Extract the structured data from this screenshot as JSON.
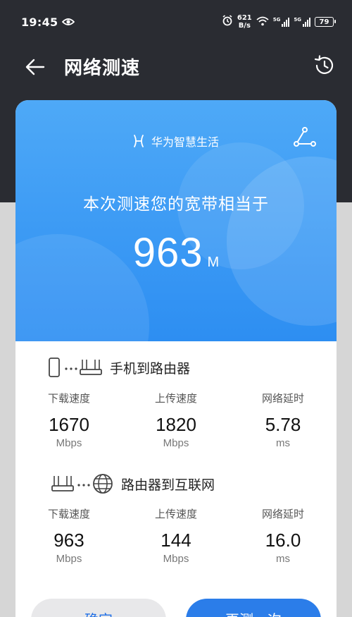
{
  "status_bar": {
    "time": "19:45",
    "net_speed_value": "621",
    "net_speed_unit": "B/s",
    "battery": "79",
    "sim1_label": "5G",
    "sim2_label": "5G"
  },
  "header": {
    "title": "网络测速"
  },
  "hero": {
    "brand": "华为智慧生活",
    "headline": "本次测速您的宽带相当于",
    "value": "963",
    "unit": "M"
  },
  "phone_to_router": {
    "title": "手机到路由器",
    "metrics": [
      {
        "label": "下载速度",
        "value": "1670",
        "unit": "Mbps"
      },
      {
        "label": "上传速度",
        "value": "1820",
        "unit": "Mbps"
      },
      {
        "label": "网络延时",
        "value": "5.78",
        "unit": "ms"
      }
    ]
  },
  "router_to_internet": {
    "title": "路由器到互联网",
    "metrics": [
      {
        "label": "下载速度",
        "value": "963",
        "unit": "Mbps"
      },
      {
        "label": "上传速度",
        "value": "144",
        "unit": "Mbps"
      },
      {
        "label": "网络延时",
        "value": "16.0",
        "unit": "ms"
      }
    ]
  },
  "buttons": {
    "confirm": "确定",
    "retest": "再测一次"
  },
  "colors": {
    "header_bg": "#2a2c32",
    "hero_blue": "#2d8ef2",
    "accent": "#2b7de9"
  }
}
